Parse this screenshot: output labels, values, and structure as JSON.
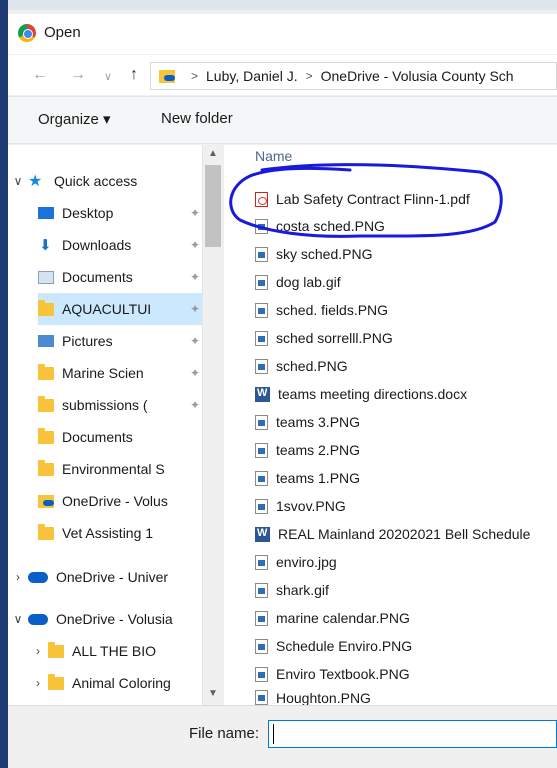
{
  "window": {
    "title": "Open"
  },
  "address": {
    "breadcrumbs": [
      "Luby, Daniel J.",
      "OneDrive - Volusia County Sch"
    ],
    "separator": ">"
  },
  "toolbar": {
    "organize_label": "Organize ▾",
    "new_folder_label": "New folder"
  },
  "nav_pane": {
    "items": [
      {
        "label": "Quick access"
      },
      {
        "label": "Desktop"
      },
      {
        "label": "Downloads"
      },
      {
        "label": "Documents"
      },
      {
        "label": "AQUACULTUI"
      },
      {
        "label": "Pictures"
      },
      {
        "label": "Marine Scien"
      },
      {
        "label": "submissions ("
      },
      {
        "label": "Documents"
      },
      {
        "label": "Environmental S"
      },
      {
        "label": "OneDrive - Volus"
      },
      {
        "label": "Vet Assisting 1"
      },
      {
        "label": "OneDrive - Univer"
      },
      {
        "label": "OneDrive - Volusia"
      },
      {
        "label": "ALL THE BIO"
      },
      {
        "label": "Animal Coloring"
      }
    ]
  },
  "file_list": {
    "column_header": "Name",
    "files": [
      {
        "name": "Lab Safety Contract Flinn-1.pdf",
        "icon": "pdf-icon"
      },
      {
        "name": "costa sched.PNG",
        "icon": "image-file-icon"
      },
      {
        "name": "sky sched.PNG",
        "icon": "image-file-icon"
      },
      {
        "name": "dog lab.gif",
        "icon": "image-file-icon"
      },
      {
        "name": "sched. fields.PNG",
        "icon": "image-file-icon"
      },
      {
        "name": "sched sorrelll.PNG",
        "icon": "image-file-icon"
      },
      {
        "name": "sched.PNG",
        "icon": "image-file-icon"
      },
      {
        "name": "teams meeting directions.docx",
        "icon": "word-doc-icon"
      },
      {
        "name": "teams 3.PNG",
        "icon": "image-file-icon"
      },
      {
        "name": "teams 2.PNG",
        "icon": "image-file-icon"
      },
      {
        "name": "teams 1.PNG",
        "icon": "image-file-icon"
      },
      {
        "name": "1svov.PNG",
        "icon": "image-file-icon"
      },
      {
        "name": "REAL Mainland 20202021 Bell Schedule",
        "icon": "word-doc-icon"
      },
      {
        "name": "enviro.jpg",
        "icon": "image-file-icon"
      },
      {
        "name": "shark.gif",
        "icon": "image-file-icon"
      },
      {
        "name": "marine calendar.PNG",
        "icon": "image-file-icon"
      },
      {
        "name": "Schedule Enviro.PNG",
        "icon": "image-file-icon"
      },
      {
        "name": "Enviro Textbook.PNG",
        "icon": "image-file-icon"
      },
      {
        "name": "Houghton.PNG",
        "icon": "image-file-icon"
      }
    ]
  },
  "footer": {
    "file_name_label": "File name:",
    "file_name_value": ""
  },
  "colors": {
    "annotation": "#1a1adb",
    "selection": "#cce8ff",
    "accent": "#0078d7"
  }
}
